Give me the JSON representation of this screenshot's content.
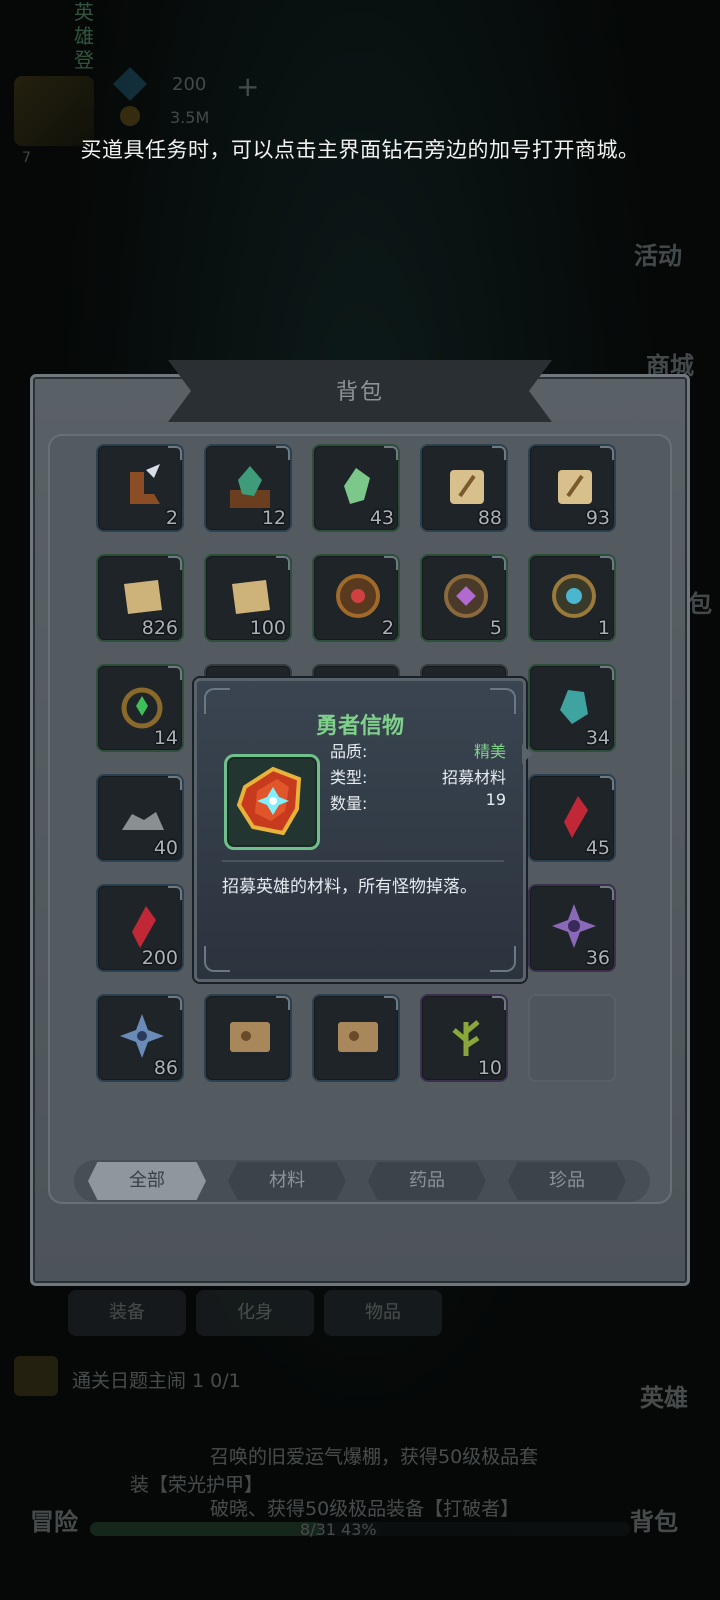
{
  "hud": {
    "vertical_label": "英雄登",
    "gems": "200",
    "gold": "3.5M",
    "plus": "+",
    "level": "7"
  },
  "side_buttons": {
    "activity": "活动",
    "shop": "商城",
    "bag_side": "包"
  },
  "hint": "买道具任务时，可以点击主界面钻石旁边的加号打开商城。",
  "backpack": {
    "title": "背包",
    "items": [
      {
        "icon": "winged-boot-icon",
        "count": "2"
      },
      {
        "icon": "green-crystal-chest-icon",
        "count": "12"
      },
      {
        "icon": "green-gem-icon",
        "count": "43"
      },
      {
        "icon": "sword-scroll-icon",
        "count": "88"
      },
      {
        "icon": "sword-scroll-icon",
        "count": "93"
      },
      {
        "icon": "parchment-icon",
        "count": "826"
      },
      {
        "icon": "parchment-icon",
        "count": "100"
      },
      {
        "icon": "red-rune-medallion-icon",
        "count": "2"
      },
      {
        "icon": "purple-rune-medallion-icon",
        "count": "5"
      },
      {
        "icon": "blue-rune-medallion-icon",
        "count": "1"
      },
      {
        "icon": "green-gem-ring-icon",
        "count": "14"
      },
      {
        "icon": "hidden",
        "count": ""
      },
      {
        "icon": "hidden",
        "count": ""
      },
      {
        "icon": "hidden",
        "count": ""
      },
      {
        "icon": "teal-crystal-icon",
        "count": "34"
      },
      {
        "icon": "ore-pile-icon",
        "count": "40"
      },
      {
        "icon": "hidden",
        "count": ""
      },
      {
        "icon": "hidden",
        "count": ""
      },
      {
        "icon": "hidden",
        "count": ""
      },
      {
        "icon": "red-shard-icon",
        "count": "45"
      },
      {
        "icon": "red-shard-icon",
        "count": "200"
      },
      {
        "icon": "hidden",
        "count": ""
      },
      {
        "icon": "hidden",
        "count": ""
      },
      {
        "icon": "hidden",
        "count": ""
      },
      {
        "icon": "purple-star-emblem-icon",
        "count": "36"
      },
      {
        "icon": "blue-star-emblem-icon",
        "count": "86"
      },
      {
        "icon": "map-scroll-icon",
        "count": ""
      },
      {
        "icon": "map-scroll-icon",
        "count": ""
      },
      {
        "icon": "herb-branch-icon",
        "count": "10"
      },
      {
        "icon": "empty",
        "count": ""
      }
    ],
    "filters": [
      "全部",
      "材料",
      "药品",
      "珍品"
    ],
    "active_filter": "全部"
  },
  "tooltip": {
    "title": "勇者信物",
    "quality_label": "品质:",
    "quality_value": "精美",
    "type_label": "类型:",
    "type_value": "招募材料",
    "qty_label": "数量:",
    "qty_value": "19",
    "description": "招募英雄的材料，所有怪物掉落。",
    "icon": "hero-token-icon"
  },
  "bottom": {
    "tabs": [
      "装备",
      "化身",
      "物品"
    ],
    "quest": "通关日题主闹 1 0/1",
    "news_1": "召唤的旧爱运气爆棚，获得50级极品套",
    "news_2": "装【荣光护甲】",
    "news_3": "破晓、获得50级极品装备【打破者】",
    "progress_text": "8/31  43%",
    "progress": 0.43,
    "adventure": "冒险",
    "bag": "背包",
    "hero": "英雄"
  }
}
